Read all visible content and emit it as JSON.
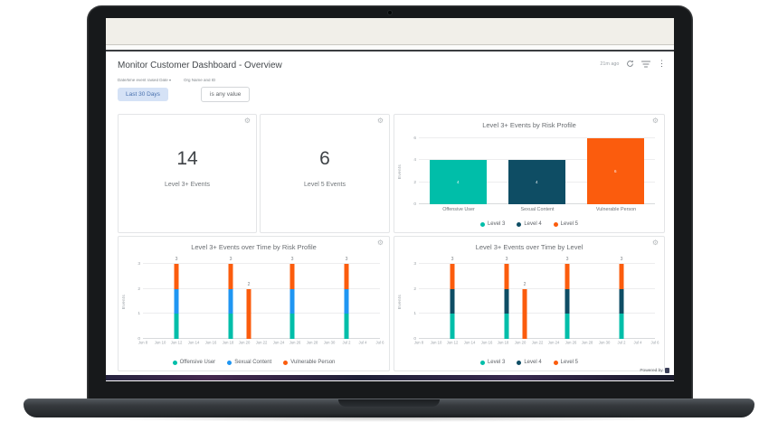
{
  "header": {
    "title": "Monitor Customer Dashboard - Overview",
    "last_refresh": "21m ago"
  },
  "icons": {
    "gear": "⚙",
    "more": "⋮"
  },
  "filters": [
    {
      "label": "Date/time event raised Date",
      "caret": "▾",
      "value": "Last 30 Days"
    },
    {
      "label": "Org Name and ID",
      "caret": "",
      "value": "is any value"
    }
  ],
  "kpis": [
    {
      "value": "14",
      "label": "Level 3+ Events"
    },
    {
      "value": "6",
      "label": "Level 5 Events"
    }
  ],
  "footer": {
    "powered_by": "Powered by"
  },
  "colors": {
    "teal": "#00BEA9",
    "navy": "#0E4D64",
    "orange": "#FB5C0D",
    "blue": "#1F96F2",
    "topbar": "#F1EFE9",
    "chip_active_bg": "#D5E2F6",
    "chip_active_text": "#4971AE"
  },
  "chart_data": [
    {
      "type": "bar",
      "title": "Level 3+ Events by Risk Profile",
      "xlabel": "",
      "ylabel": "Events",
      "ylim": [
        0,
        6
      ],
      "yticks": [
        0,
        2,
        4,
        6
      ],
      "grid": true,
      "legend_position": "bottom",
      "categories": [
        "Offensive User",
        "Sexual Content",
        "Vulnerable Person"
      ],
      "values": [
        4,
        4,
        6
      ],
      "bar_value_labels": [
        "4",
        "4",
        "6"
      ],
      "bar_colors": [
        "#00BEA9",
        "#0E4D64",
        "#FB5C0D"
      ],
      "legend": [
        {
          "label": "Level 3",
          "color": "#00BEA9"
        },
        {
          "label": "Level 4",
          "color": "#0E4D64"
        },
        {
          "label": "Level 5",
          "color": "#FB5C0D"
        }
      ]
    },
    {
      "type": "bar-stacked",
      "title": "Level 3+ Events over Time by Risk Profile",
      "xlabel": "",
      "ylabel": "Events",
      "ylim": [
        0,
        3
      ],
      "yticks": [
        0,
        1,
        2,
        3
      ],
      "grid": true,
      "legend_position": "bottom",
      "xticks": [
        "Jun 8",
        "Jun 10",
        "Jun 12",
        "Jun 14",
        "Jun 16",
        "Jun 18",
        "Jun 20",
        "Jun 22",
        "Jun 24",
        "Jun 26",
        "Jun 28",
        "Jun 30",
        "Jul 2",
        "Jul 4",
        "Jul 6"
      ],
      "series": [
        {
          "name": "Offensive User",
          "color": "#00BEA9"
        },
        {
          "name": "Sexual Content",
          "color": "#1F96F2"
        },
        {
          "name": "Vulnerable Person",
          "color": "#FB5C0D"
        }
      ],
      "bars": [
        {
          "x": "Jun 12",
          "pos": 0.14,
          "segments": [
            1,
            1,
            1
          ],
          "total": "3"
        },
        {
          "x": "Jun 18",
          "pos": 0.372,
          "segments": [
            1,
            1,
            1
          ],
          "total": "3"
        },
        {
          "x": "Jun 21",
          "pos": 0.447,
          "segments": [
            0,
            0,
            2
          ],
          "total": "2"
        },
        {
          "x": "Jun 26",
          "pos": 0.63,
          "segments": [
            1,
            1,
            1
          ],
          "total": "3"
        },
        {
          "x": "Jul 2",
          "pos": 0.86,
          "segments": [
            1,
            1,
            1
          ],
          "total": "3"
        }
      ],
      "legend": [
        {
          "label": "Offensive User",
          "color": "#00BEA9"
        },
        {
          "label": "Sexual Content",
          "color": "#1F96F2"
        },
        {
          "label": "Vulnerable Person",
          "color": "#FB5C0D"
        }
      ]
    },
    {
      "type": "bar-stacked",
      "title": "Level 3+ Events over Time by Level",
      "xlabel": "",
      "ylabel": "Events",
      "ylim": [
        0,
        3
      ],
      "yticks": [
        0,
        1,
        2,
        3
      ],
      "grid": true,
      "legend_position": "bottom",
      "xticks": [
        "Jun 8",
        "Jun 10",
        "Jun 12",
        "Jun 14",
        "Jun 16",
        "Jun 18",
        "Jun 20",
        "Jun 22",
        "Jun 24",
        "Jun 26",
        "Jun 28",
        "Jun 30",
        "Jul 2",
        "Jul 4",
        "Jul 6"
      ],
      "series": [
        {
          "name": "Level 3",
          "color": "#00BEA9"
        },
        {
          "name": "Level 4",
          "color": "#0E4D64"
        },
        {
          "name": "Level 5",
          "color": "#FB5C0D"
        }
      ],
      "bars": [
        {
          "x": "Jun 12",
          "pos": 0.14,
          "segments": [
            1,
            1,
            1
          ],
          "total": "3"
        },
        {
          "x": "Jun 18",
          "pos": 0.372,
          "segments": [
            1,
            1,
            1
          ],
          "total": "3"
        },
        {
          "x": "Jun 21",
          "pos": 0.447,
          "segments": [
            0,
            0,
            2
          ],
          "total": "2"
        },
        {
          "x": "Jun 26",
          "pos": 0.63,
          "segments": [
            1,
            1,
            1
          ],
          "total": "3"
        },
        {
          "x": "Jul 2",
          "pos": 0.86,
          "segments": [
            1,
            1,
            1
          ],
          "total": "3"
        }
      ],
      "legend": [
        {
          "label": "Level 3",
          "color": "#00BEA9"
        },
        {
          "label": "Level 4",
          "color": "#0E4D64"
        },
        {
          "label": "Level 5",
          "color": "#FB5C0D"
        }
      ]
    }
  ]
}
